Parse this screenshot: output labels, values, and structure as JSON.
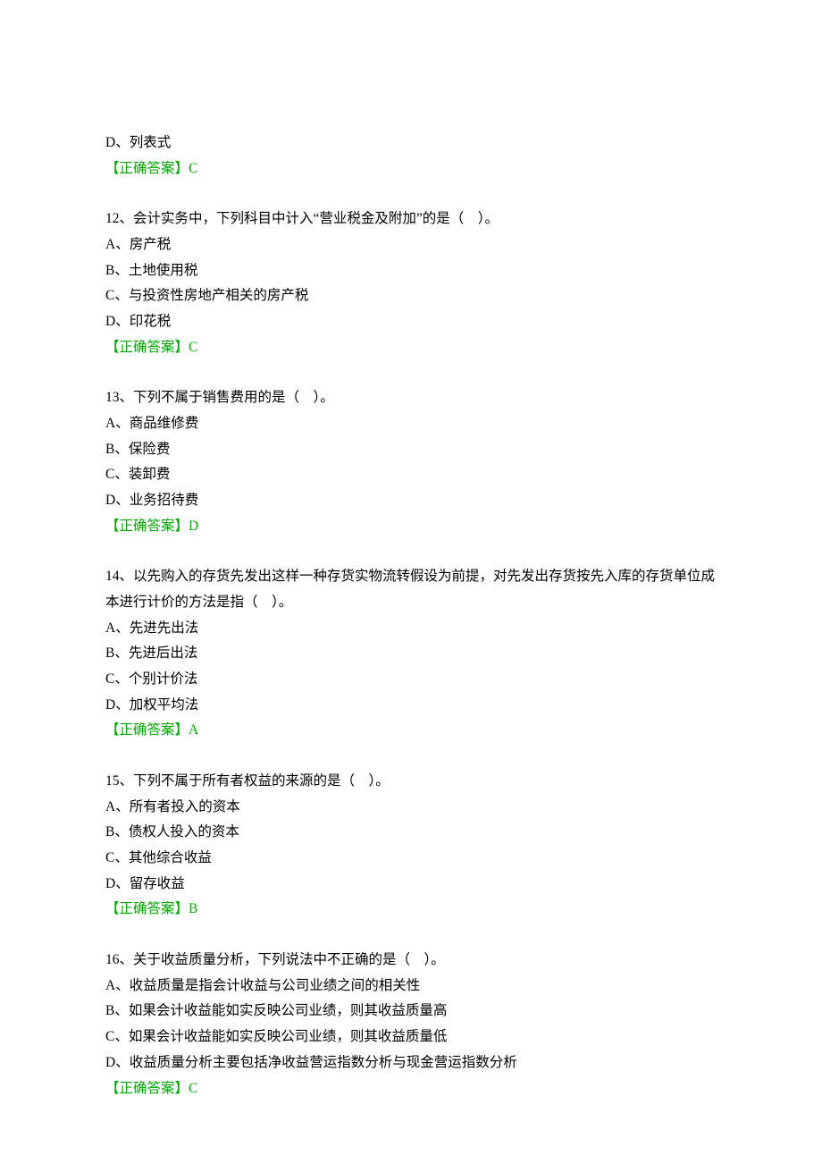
{
  "answer_label_prefix": "【正确答案】",
  "partial_q11": {
    "option_d": "D、列表式",
    "answer": "C"
  },
  "q12": {
    "stem": "12、会计实务中，下列科目中计入“营业税金及附加”的是（　）。",
    "a": "A、房产税",
    "b": "B、土地使用税",
    "c": "C、与投资性房地产相关的房产税",
    "d": "D、印花税",
    "answer": "C"
  },
  "q13": {
    "stem": "13、下列不属于销售费用的是（　）。",
    "a": "A、商品维修费",
    "b": "B、保险费",
    "c": "C、装卸费",
    "d": "D、业务招待费",
    "answer": "D"
  },
  "q14": {
    "stem": "14、以先购入的存货先发出这样一种存货实物流转假设为前提，对先发出存货按先入库的存货单位成本进行计价的方法是指（　）。",
    "a": "A、先进先出法",
    "b": "B、先进后出法",
    "c": "C、个别计价法",
    "d": "D、加权平均法",
    "answer": "A"
  },
  "q15": {
    "stem": "15、下列不属于所有者权益的来源的是（　）。",
    "a": "A、所有者投入的资本",
    "b": "B、债权人投入的资本",
    "c": "C、其他综合收益",
    "d": "D、留存收益",
    "answer": "B"
  },
  "q16": {
    "stem": "16、关于收益质量分析，下列说法中不正确的是（　）。",
    "a": "A、收益质量是指会计收益与公司业绩之间的相关性",
    "b": "B、如果会计收益能如实反映公司业绩，则其收益质量高",
    "c": "C、如果会计收益能如实反映公司业绩，则其收益质量低",
    "d": "D、收益质量分析主要包括净收益营运指数分析与现金营运指数分析",
    "answer": "C"
  }
}
